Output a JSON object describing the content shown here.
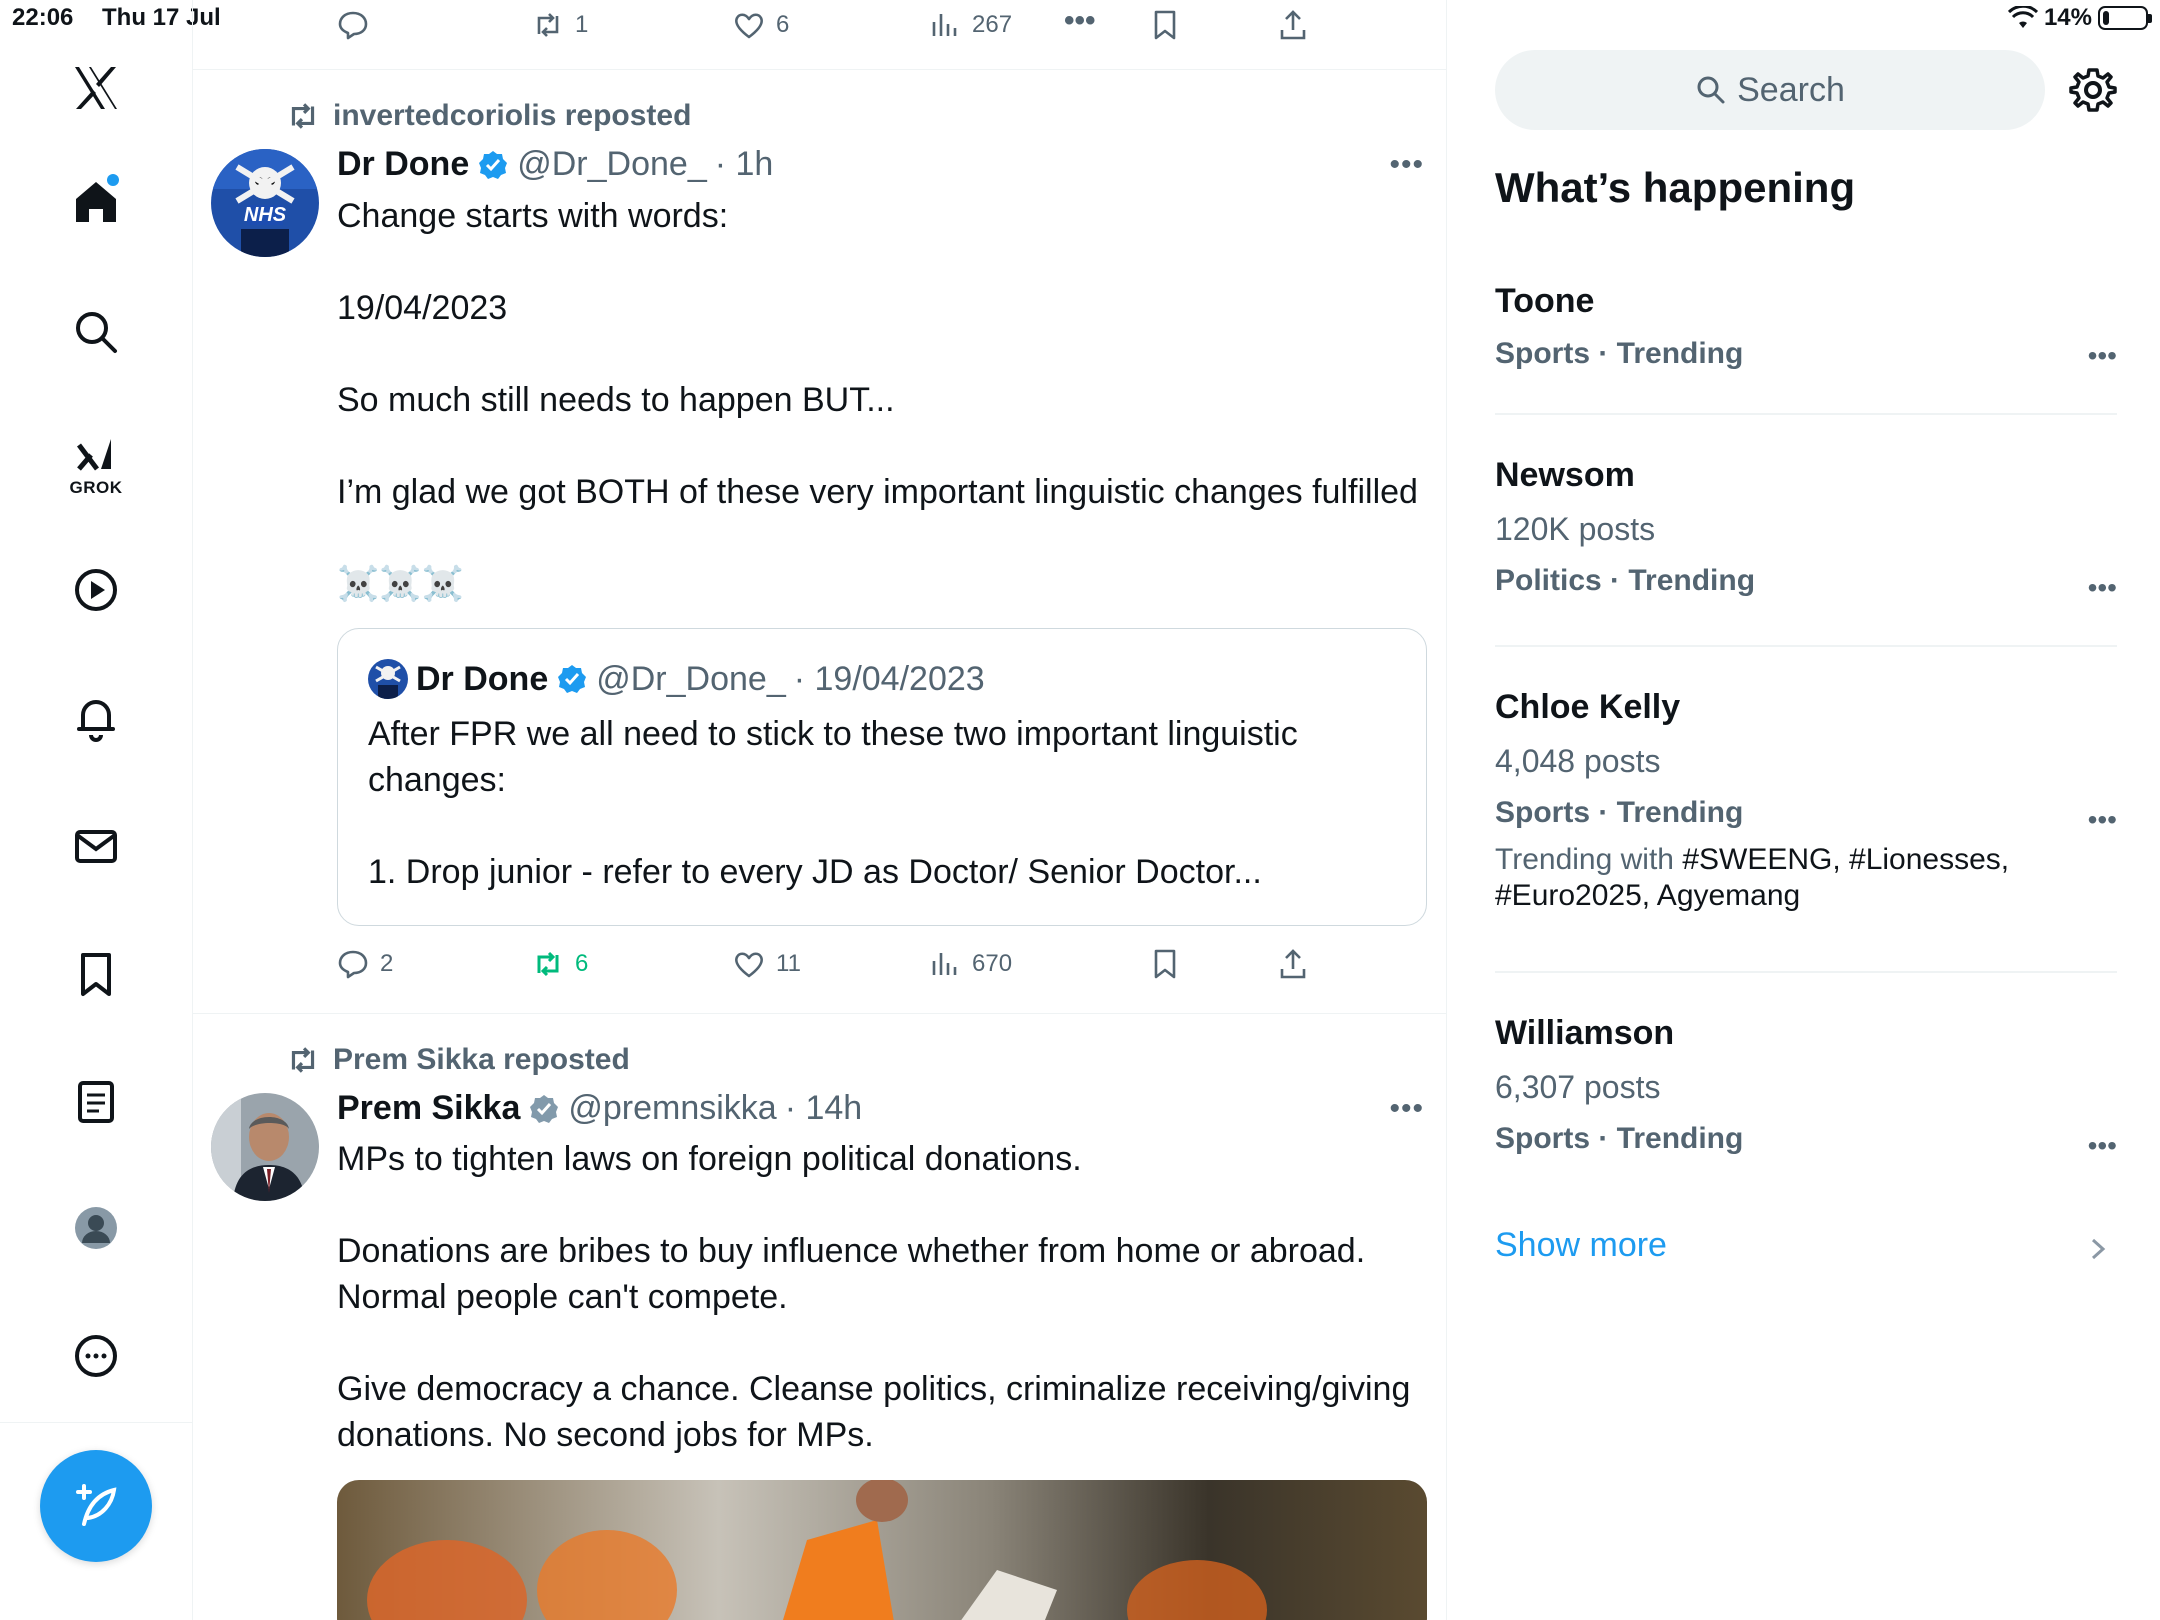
{
  "status_bar": {
    "time": "22:06",
    "date": "Thu 17 Jul",
    "battery_text": "14%",
    "battery_level": 0.14
  },
  "top_actions": {
    "reply": "",
    "repost": "1",
    "like": "6",
    "views": "267"
  },
  "tweet1": {
    "reposted_by": "invertedcoriolis reposted",
    "author": "Dr Done",
    "handle": "@Dr_Done_",
    "time": "· 1h",
    "text": "Change starts with words:\n\n19/04/2023\n\nSo much still needs to happen BUT...\n\nI’m glad we got BOTH of these very important linguistic changes fulfilled\n\n☠️☠️☠️",
    "avatar_text": "NHS",
    "quote": {
      "author": "Dr Done",
      "handle": "@Dr_Done_",
      "time": "· 19/04/2023",
      "text": "After FPR we all need to stick to these two important linguistic changes:\n\n1. Drop junior - refer to every JD as Doctor/ Senior Doctor..."
    },
    "actions": {
      "reply": "2",
      "repost": "6",
      "like": "11",
      "views": "670"
    }
  },
  "tweet2": {
    "reposted_by": "Prem Sikka reposted",
    "author": "Prem Sikka",
    "handle": "@premnsikka",
    "time": "· 14h",
    "text": "MPs to tighten laws on foreign political donations.\n\nDonations are bribes to buy influence whether from home or abroad. Normal people can't compete.\n\nGive democracy a chance. Cleanse politics, criminalize receiving/giving donations. No second jobs for MPs."
  },
  "nav": {
    "grok_label": "GROK"
  },
  "search": {
    "placeholder": "Search"
  },
  "whats_happening": {
    "title": "What’s happening",
    "trends": [
      {
        "name": "Toone",
        "meta": "Sports · Trending"
      },
      {
        "name": "Newsom",
        "count": "120K posts",
        "meta": "Politics · Trending"
      },
      {
        "name": "Chloe Kelly",
        "count": "4,048 posts",
        "meta": "Sports · Trending",
        "with_prefix": "Trending with ",
        "with_tags": "#SWEENG, #Lionesses, #Euro2025, Agyemang"
      },
      {
        "name": "Williamson",
        "count": "6,307 posts",
        "meta": "Sports · Trending"
      }
    ],
    "show_more": "Show more"
  },
  "colors": {
    "accent": "#1d9bf0",
    "secondary_text": "#536471",
    "repost_green": "#00ba7c",
    "divider": "#eff3f4"
  }
}
